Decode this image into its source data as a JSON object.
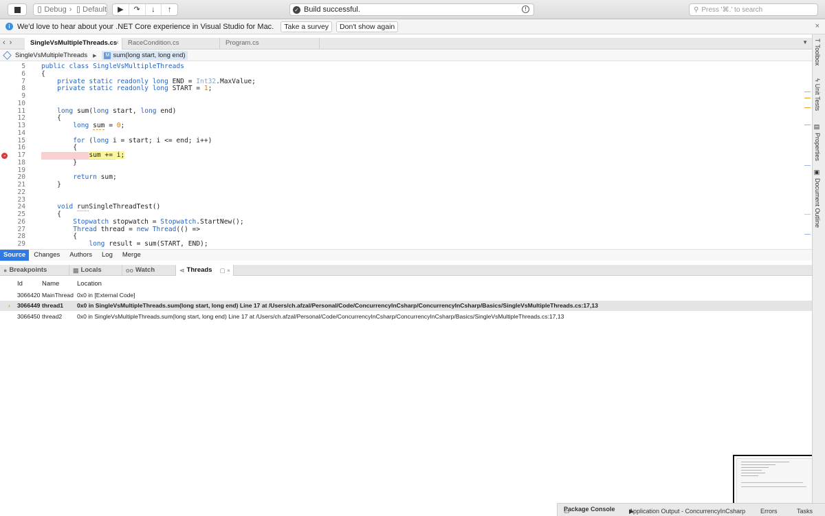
{
  "toolbar": {
    "config": "Debug",
    "device": "Default",
    "build_status": "Build successful.",
    "search_placeholder": "Press '⌘.' to search"
  },
  "infobar": {
    "message": "We'd love to hear about your .NET Core experience in Visual Studio for Mac.",
    "survey_button": "Take a survey",
    "dismiss_button": "Don't show again"
  },
  "tabs": [
    "SingleVsMultipleThreads.cs",
    "RaceCondition.cs",
    "Program.cs"
  ],
  "breadcrumb": {
    "class": "SingleVsMultipleThreads",
    "method": "sum(long start, long end)"
  },
  "code": {
    "line_numbers": [
      "5",
      "6",
      "7",
      "8",
      "9",
      "10",
      "11",
      "12",
      "13",
      "14",
      "15",
      "16",
      "17",
      "18",
      "19",
      "20",
      "21",
      "22",
      "23",
      "24",
      "25",
      "26",
      "27",
      "28",
      "29"
    ]
  },
  "source_tabs": [
    "Source",
    "Changes",
    "Authors",
    "Log",
    "Merge"
  ],
  "pads": [
    "Breakpoints",
    "Locals",
    "Watch",
    "Threads"
  ],
  "threads": {
    "columns": [
      "Id",
      "Name",
      "Location"
    ],
    "rows": [
      {
        "id": "3066420",
        "name": "MainThread",
        "location": "0x0 in [External Code]"
      },
      {
        "id": "3066449",
        "name": "thread1",
        "location": "0x0 in SingleVsMultipleThreads.sum(long start, long end) Line 17 at /Users/ch.afzal/Personal/Code/ConcurrencyInCsharp/ConcurrencyInCsharp/Basics/SingleVsMultipleThreads.cs:17,13"
      },
      {
        "id": "3066450",
        "name": "thread2",
        "location": "0x0 in SingleVsMultipleThreads.sum(long start, long end) Line 17 at /Users/ch.afzal/Personal/Code/ConcurrencyInCsharp/ConcurrencyInCsharp/Basics/SingleVsMultipleThreads.cs:17,13"
      }
    ]
  },
  "bottom": {
    "package_console": "Package Console",
    "app_output": "Application Output - ConcurrencyInCsharp",
    "errors": "Errors",
    "tasks": "Tasks"
  },
  "dock": [
    "Toolbox",
    "Unit Tests",
    "Properties",
    "Document Outline"
  ],
  "colors": {
    "accent": "#2e7ae6",
    "breakpoint": "#d83a3a",
    "current_line": "#fbf59b",
    "keyword": "#2465c4"
  }
}
